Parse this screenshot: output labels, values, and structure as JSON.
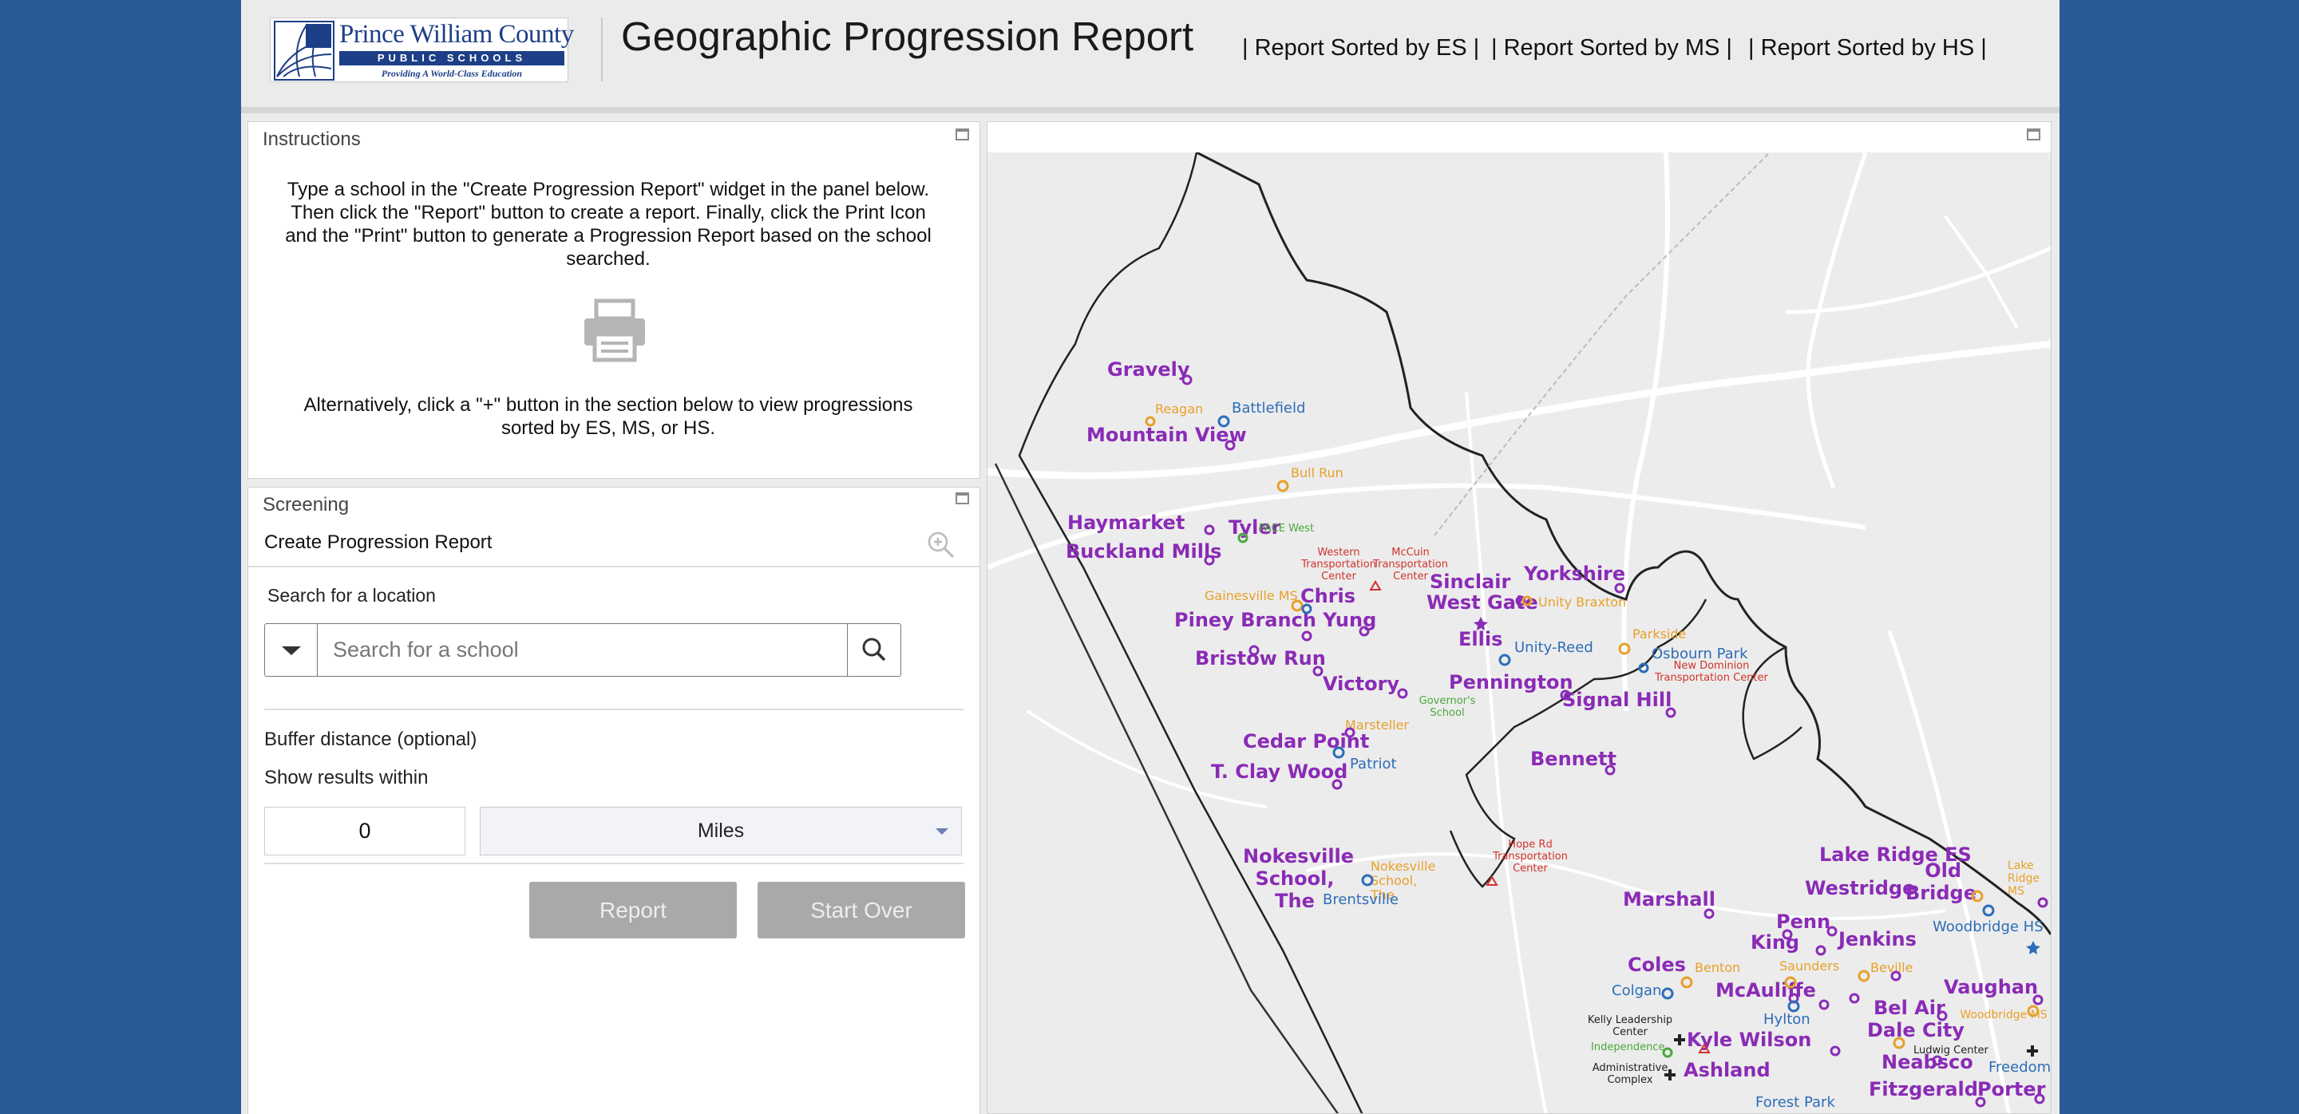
{
  "header": {
    "logo": {
      "name": "Prince William County",
      "band": "PUBLIC SCHOOLS",
      "tagline": "Providing A World-Class Education"
    },
    "title": "Geographic Progression Report",
    "links": [
      "| Report Sorted by ES |",
      "| Report Sorted by MS |",
      "| Report Sorted by HS |"
    ]
  },
  "instructions": {
    "title": "Instructions",
    "text": "Type a school in the \"Create Progression Report\" widget in the panel below. Then click the \"Report\" button to create a report. Finally, click the Print Icon and the \"Print\" button to generate a Progression Report based on the school searched.",
    "print_icon": "printer-icon",
    "alt_text": "Alternatively, click a \"+\" button in the section below to view progressions sorted by ES, MS, or HS."
  },
  "screening": {
    "title": "Screening",
    "create_label": "Create Progression Report",
    "zoom_icon": "zoom-in-icon",
    "search": {
      "label": "Search for a location",
      "placeholder": "Search for a school",
      "value": ""
    },
    "buffer_label": "Buffer distance (optional)",
    "within_label": "Show results within",
    "distance": "0",
    "unit": "Miles",
    "report_button": "Report",
    "start_over_button": "Start Over"
  },
  "map": {
    "elementary": [
      "Gravely",
      "Mountain View",
      "Haymarket",
      "Tyler",
      "Buckland Mills",
      "Chris",
      "Piney Branch Yung",
      "Bristow Run",
      "Victory",
      "Cedar Point",
      "T. Clay Wood",
      "Nokesville School, The",
      "Sinclair",
      "West Gate",
      "Yorkshire",
      "Ellis",
      "Pennington",
      "Signal Hill",
      "Bennett",
      "Marshall",
      "Lake Ridge ES",
      "Westridge",
      "Old Bridge",
      "Penn",
      "King",
      "Jenkins",
      "Coles",
      "McAuliffe",
      "Vaughan",
      "Bel Air",
      "Dale City",
      "Kyle Wilson",
      "Neabsco",
      "Ashland",
      "Fitzgerald",
      "Porter"
    ],
    "middle": [
      "Reagan",
      "Bull Run",
      "Gainesville MS",
      "Unity Braxton",
      "Parkside",
      "Marsteller",
      "Nokesville School, The",
      "Benton",
      "Saunders",
      "Beville",
      "Lake Ridge MS",
      "Woodbridge MS"
    ],
    "high": [
      "Battlefield",
      "Unity-Reed",
      "Osbourn Park",
      "Patriot",
      "Brentsville",
      "Colgan",
      "Hylton",
      "Woodbridge HS",
      "Freedom",
      "Forest Park"
    ],
    "centers": [
      "Western Transportation Center",
      "McCuin Transportation Center",
      "New Dominion Transportation Center",
      "Hope Rd Transportation Center"
    ],
    "programs": [
      "PACE West",
      "Governor's School",
      "Independence"
    ],
    "admin": [
      "Kelly Leadership Center",
      "Ludwig Center",
      "Administrative Complex"
    ],
    "colors": {
      "es": "#8a2bb6",
      "ms": "#e8a02a",
      "hs": "#2c6db8",
      "center": "#d0342c",
      "program": "#4aa83a"
    }
  }
}
